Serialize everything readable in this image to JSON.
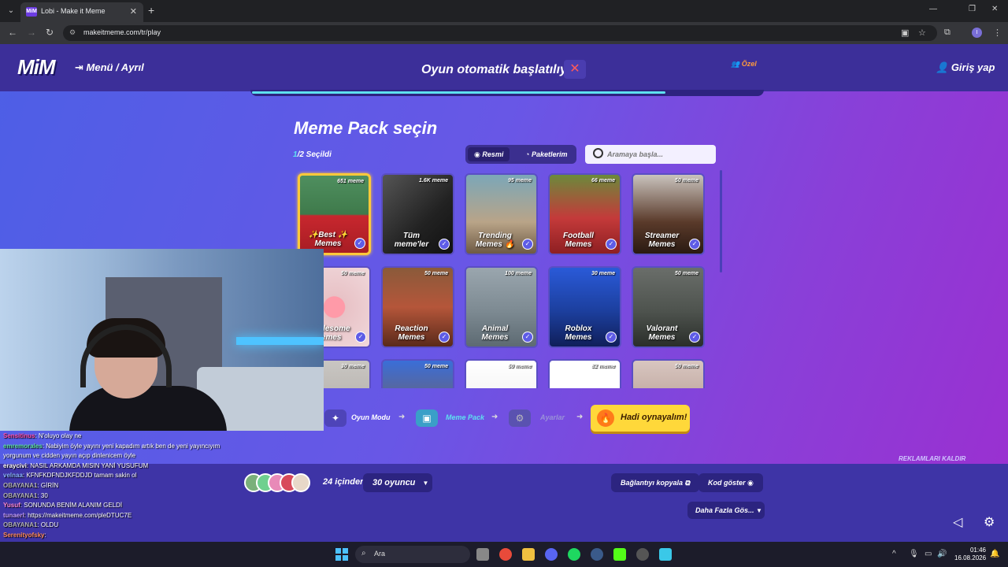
{
  "browser": {
    "tab_title": "Lobi - Make it Meme",
    "favicon_text": "MiM",
    "url": "makeitmeme.com/tr/play",
    "profile_initial": "I"
  },
  "header": {
    "logo": "MiM",
    "menu_label": "Menü / Ayrıl",
    "auto_start_text": "Oyun otomatik başlatılıyor",
    "countdown_progress": 0.81,
    "private_label": "Özel",
    "login_label": "Giriş yap"
  },
  "packs": {
    "title": "Meme Pack seçin",
    "selected_num": "1",
    "selected_rest": "/2 Seçildi",
    "toggle_official": "Resmi",
    "toggle_mine": "Paketlerim",
    "search_placeholder": "Aramaya başla...",
    "cards": [
      {
        "label": "✨Best ✨ Memes",
        "count": "651 meme",
        "bg": "linear-gradient(180deg,#4f8f5f 0%,#3f7a4b 50%,#c8272e 52%,#a71d24 100%)",
        "selected": true
      },
      {
        "label": "Tüm meme'ler",
        "count": "1.6K meme",
        "bg": "linear-gradient(135deg,#555 0%,#222 60%,#111 100%)",
        "selected": false
      },
      {
        "label": "Trending Memes 🔥",
        "count": "95 meme",
        "bg": "linear-gradient(180deg,#7ba7b8 0%,#b9a488 60%,#6e5a44 100%)",
        "selected": false
      },
      {
        "label": "Football Memes",
        "count": "66 meme",
        "bg": "linear-gradient(180deg,#6b8a3b 0%,#c43a3a 55%,#8e1f22 100%)",
        "selected": false
      },
      {
        "label": "Streamer Memes",
        "count": "50 meme",
        "bg": "linear-gradient(180deg,#c9c3bd 0%,#5a3a2a 60%,#2a1a12 100%)",
        "selected": false
      },
      {
        "label": "Wholesome Memes",
        "count": "50 meme",
        "bg": "radial-gradient(circle,#ff9aa8 20%,#e8c2c6 21%,#f0d8db 100%)",
        "selected": false
      },
      {
        "label": "Reaction Memes",
        "count": "50 meme",
        "bg": "linear-gradient(180deg,#8a5a3a 0%,#b5563a 50%,#5a2a1a 100%)",
        "selected": false
      },
      {
        "label": "Animal Memes",
        "count": "100 meme",
        "bg": "linear-gradient(180deg,#9aa6ae 0%,#7d8a92 55%,#5d6a72 100%)",
        "selected": false
      },
      {
        "label": "Roblox Memes",
        "count": "30 meme",
        "bg": "linear-gradient(180deg,#2a5ad8 0%,#1c3f9e 55%,#101f5a 100%)",
        "selected": false
      },
      {
        "label": "Valorant Memes",
        "count": "50 meme",
        "bg": "linear-gradient(180deg,#6a6e6a 0%,#4e534e 55%,#2a2e2a 100%)",
        "selected": false
      },
      {
        "label": "",
        "count": "30 meme",
        "bg": "linear-gradient(180deg,#c9c6c2 0%,#a8a4a0 100%)",
        "selected": false
      },
      {
        "label": "",
        "count": "50 meme",
        "bg": "linear-gradient(180deg,#3a6ed8 0%,#8a5a3a 100%)",
        "selected": false
      },
      {
        "label": "",
        "count": "50 meme",
        "bg": "linear-gradient(180deg,#ffffff 0%,#e8e8e8 100%)",
        "selected": false
      },
      {
        "label": "",
        "count": "82 meme",
        "bg": "linear-gradient(180deg,#ffffff 0%,#ffffff 70%,#d82a3a 71%,#2a3ad8 100%)",
        "selected": false
      },
      {
        "label": "",
        "count": "50 meme",
        "bg": "linear-gradient(180deg,#d8c6c0 0%,#a88a80 100%)",
        "selected": false
      }
    ]
  },
  "steps": {
    "mode": "Oyun Modu",
    "pack": "Meme Pack",
    "settings": "Ayarlar",
    "play": "Hadi oynayalım!"
  },
  "remove_ads": "REKLAMLARI KALDIR",
  "lobby": {
    "players_of": "24 içinden",
    "player_count": "30 oyuncu",
    "copy_link": "Bağlantıyı kopyala",
    "show_code": "Kod göster",
    "show_more": "Daha Fazla Gös..."
  },
  "chat": [
    {
      "user": "Sensitinus",
      "text": ": N'oluyo olay ne",
      "color": "#ff4fa8"
    },
    {
      "user": "emremorales",
      "text": ": Nabiyim öyle yayını yeni kapadım artık ben de yeni yayıncıyım",
      "color": "#5ee0a0"
    },
    {
      "user": "",
      "text": "yorgunum ve cidden yayın açıp dinlenicem öyle",
      "color": "#fff"
    },
    {
      "user": "eraycivi",
      "text": ": NASIL ARKAMDA MISIN YANİ YUSUFUM",
      "color": "#fff"
    },
    {
      "user": "velnaa",
      "text": ": KFNFKDFNDJKFDDJD tamam sakin ol",
      "color": "#8ab4ff"
    },
    {
      "user": "OBAYANA1",
      "text": ": GİRİN",
      "color": "#b0b0b0"
    },
    {
      "user": "OBAYANA1",
      "text": ": 30",
      "color": "#b0b0b0"
    },
    {
      "user": "Yusuf",
      "text": ": SONUNDA BENİM ALANIM GELDİ",
      "color": "#ff8ad8"
    },
    {
      "user": "tunaerl",
      "text": ": https://makeitmeme.com/pleDTUC7E",
      "color": "#c8a0ff"
    },
    {
      "user": "OBAYANA1",
      "text": ": OLDU",
      "color": "#b0b0b0"
    },
    {
      "user": "Serenityofsky",
      "text": ":",
      "color": "#ff8a5a"
    }
  ],
  "taskbar": {
    "search_label": "Ara",
    "time": "01:46",
    "date": "16.08.2026"
  }
}
